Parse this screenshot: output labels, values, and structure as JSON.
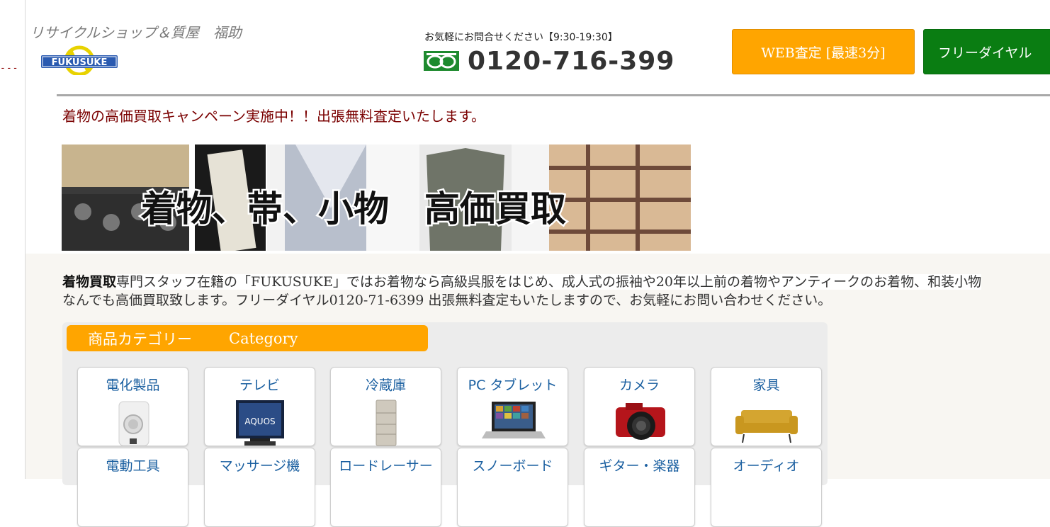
{
  "header": {
    "shop_name": "リサイクルショップ＆質屋　福助",
    "logo_text": "FUKUSUKE",
    "phone_caption": "お気軽にお問合せください【9:30-19:30】",
    "phone_number": "0120-716-399",
    "buttons": {
      "web_appraisal": "WEB査定 [最速3分]",
      "free_dial": "フリーダイヤル"
    }
  },
  "campaign_text": "着物の高価買取キャンペーン実施中！！出張無料査定いたします。",
  "banner": {
    "text": "着物、帯、小物　高価買取"
  },
  "intro": {
    "lead": "着物買取",
    "line1": "専門スタッフ在籍の「FUKUSUKE」ではお着物なら高級呉服をはじめ、成人式の振袖や20年以上前の着物やアンティークのお着物、和装小物",
    "line2": "なんでも高価買取致します。フリーダイヤル0120-71-6399 出張無料査定もいたしますので、お気軽にお問い合わせください。"
  },
  "categories": {
    "title_jp": "商品カテゴリー",
    "title_en": "Category",
    "items": [
      {
        "label": "電化製品",
        "icon": "washing-machine-icon"
      },
      {
        "label": "テレビ",
        "icon": "tv-icon"
      },
      {
        "label": "冷蔵庫",
        "icon": "refrigerator-icon"
      },
      {
        "label": "PC タブレット",
        "icon": "laptop-icon"
      },
      {
        "label": "カメラ",
        "icon": "camera-icon"
      },
      {
        "label": "家具",
        "icon": "sofa-icon"
      },
      {
        "label": "電動工具"
      },
      {
        "label": "マッサージ機"
      },
      {
        "label": "ロードレーサー"
      },
      {
        "label": "スノーボード"
      },
      {
        "label": "ギター・楽器"
      },
      {
        "label": "オーディオ"
      }
    ]
  },
  "colors": {
    "accent_orange": "#ffa500",
    "accent_green": "#0a7d12",
    "campaign_text": "#7a0000",
    "category_label": "#1a5fa0"
  }
}
